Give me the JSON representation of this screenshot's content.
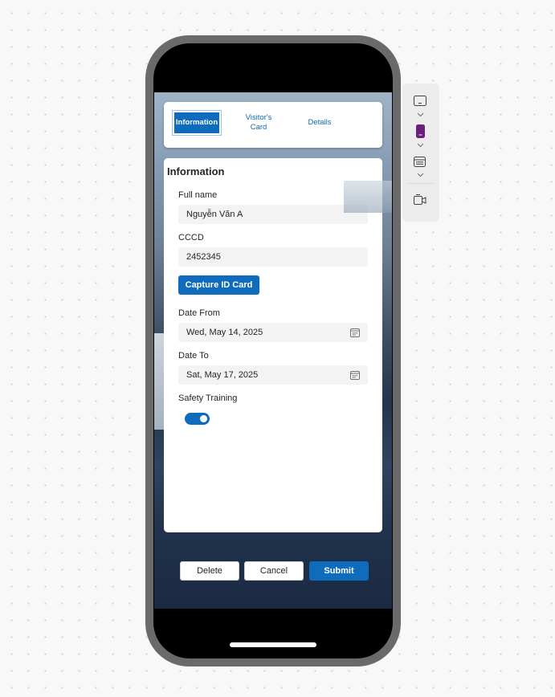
{
  "tabs": [
    {
      "label": "Information",
      "active": true
    },
    {
      "label": "Visitor's Card",
      "active": false
    },
    {
      "label": "Details",
      "active": false
    }
  ],
  "form": {
    "title": "Information",
    "full_name": {
      "label": "Full name",
      "value": "Nguyễn Văn A"
    },
    "cccd": {
      "label": "CCCD",
      "value": "2452345"
    },
    "capture_label": "Capture ID Card",
    "date_from": {
      "label": "Date From",
      "value": "Wed, May 14, 2025"
    },
    "date_to": {
      "label": "Date To",
      "value": "Sat, May 17, 2025"
    },
    "safety_training": {
      "label": "Safety Training",
      "on": true
    }
  },
  "actions": {
    "delete": "Delete",
    "cancel": "Cancel",
    "submit": "Submit"
  },
  "side_panel": {
    "icons": [
      "tablet-landscape-icon",
      "phone-portrait-icon",
      "browser-window-icon",
      "screen-share-icon"
    ]
  },
  "colors": {
    "accent": "#0f6cbd",
    "phone_frame": "#6a6a6a",
    "toggle_on": "#0f6cbd"
  }
}
